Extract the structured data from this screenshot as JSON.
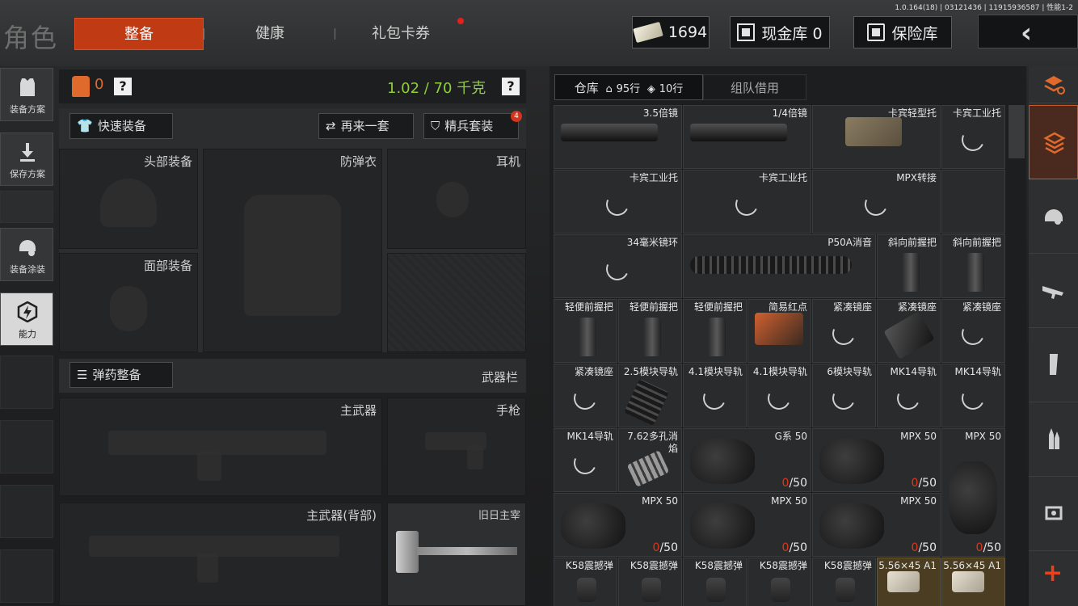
{
  "header": {
    "version": "1.0.164(18) | 03121436 | 11915936587 | 性能1-2",
    "title": "角色",
    "tabs": [
      {
        "label": "整备",
        "active": true
      },
      {
        "label": "健康",
        "active": false
      },
      {
        "label": "礼包卡券",
        "active": false
      }
    ],
    "currency": "1694",
    "cash_vault": "现金库 0",
    "safe_box": "保险库",
    "back": "‹"
  },
  "left_sidebar": {
    "items": [
      {
        "label": "装备方案",
        "icon": "vest-icon"
      },
      {
        "label": "保存方案",
        "icon": "download-icon"
      },
      {
        "label": "装备涂装",
        "icon": "helmet-paint-icon"
      },
      {
        "label": "能力",
        "icon": "ability-icon",
        "active": true
      }
    ]
  },
  "loadout": {
    "armor_count": "0",
    "help": "?",
    "weight": "1.02 / 70 千克",
    "quick_equip": "快速装备",
    "again": "再来一套",
    "elite": "精兵套装",
    "elite_badge": "4",
    "slots": {
      "head": "头部装备",
      "armor": "防弹衣",
      "headset": "耳机",
      "face": "面部装备"
    },
    "ammo_btn": "弹药整备",
    "weapon_bar": "武器栏",
    "primary": "主武器",
    "pistol": "手枪",
    "primary_back": "主武器(背部)",
    "melee": "旧日主宰"
  },
  "warehouse": {
    "tab_label": "仓库",
    "rows": "95行",
    "tags": "10行",
    "team_borrow": "组队借用",
    "items": [
      {
        "name": "3.5倍镜"
      },
      {
        "name": "1/4倍镜"
      },
      {
        "name": "卡宾轻型托"
      },
      {
        "name": "卡宾工业托"
      },
      {
        "name": "卡宾工业托"
      },
      {
        "name": "卡宾工业托"
      },
      {
        "name": "MPX转接"
      },
      {
        "name": ""
      },
      {
        "name": "34毫米镜环"
      },
      {
        "name": "P50A消音"
      },
      {
        "name": "斜向前握把"
      },
      {
        "name": "斜向前握把"
      },
      {
        "name": "轻便前握把"
      },
      {
        "name": "轻便前握把"
      },
      {
        "name": "轻便前握把"
      },
      {
        "name": "轻便前握把"
      },
      {
        "name": "简易红点"
      },
      {
        "name": "紧凑镜座"
      },
      {
        "name": "紧凑镜座"
      },
      {
        "name": "紧凑镜座"
      },
      {
        "name": "紧凑镜座"
      },
      {
        "name": "2.5模块导轨"
      },
      {
        "name": "4.1模块导轨"
      },
      {
        "name": "4.1模块导轨"
      },
      {
        "name": "6模块导轨"
      },
      {
        "name": "MK14导轨"
      },
      {
        "name": "MK14导轨"
      },
      {
        "name": "MK14导轨"
      },
      {
        "name": "7.62多孔消焰"
      },
      {
        "name": "G系 50",
        "count_red": "0",
        "count": "/50"
      },
      {
        "name": "MPX 50",
        "count_red": "0",
        "count": "/50"
      },
      {
        "name": "MPX 50",
        "count_red": "0",
        "count": "/50"
      },
      {
        "name": "MPX 50",
        "count_red": "0",
        "count": "/50"
      },
      {
        "name": "MPX 50",
        "count_red": "0",
        "count": "/50"
      },
      {
        "name": "MPX 50",
        "count_red": "0",
        "count": "/50"
      },
      {
        "name": "K58震撼弹"
      },
      {
        "name": "K58震撼弹"
      },
      {
        "name": "K58震撼弹"
      },
      {
        "name": "K58震撼弹"
      },
      {
        "name": "K58震撼弹"
      },
      {
        "name": "5.56×45 A1"
      },
      {
        "name": "5.56×45 A1"
      }
    ]
  },
  "colors": {
    "accent": "#c03a14",
    "weight_green": "#8fcf3a",
    "warning_red": "#e0341e"
  }
}
